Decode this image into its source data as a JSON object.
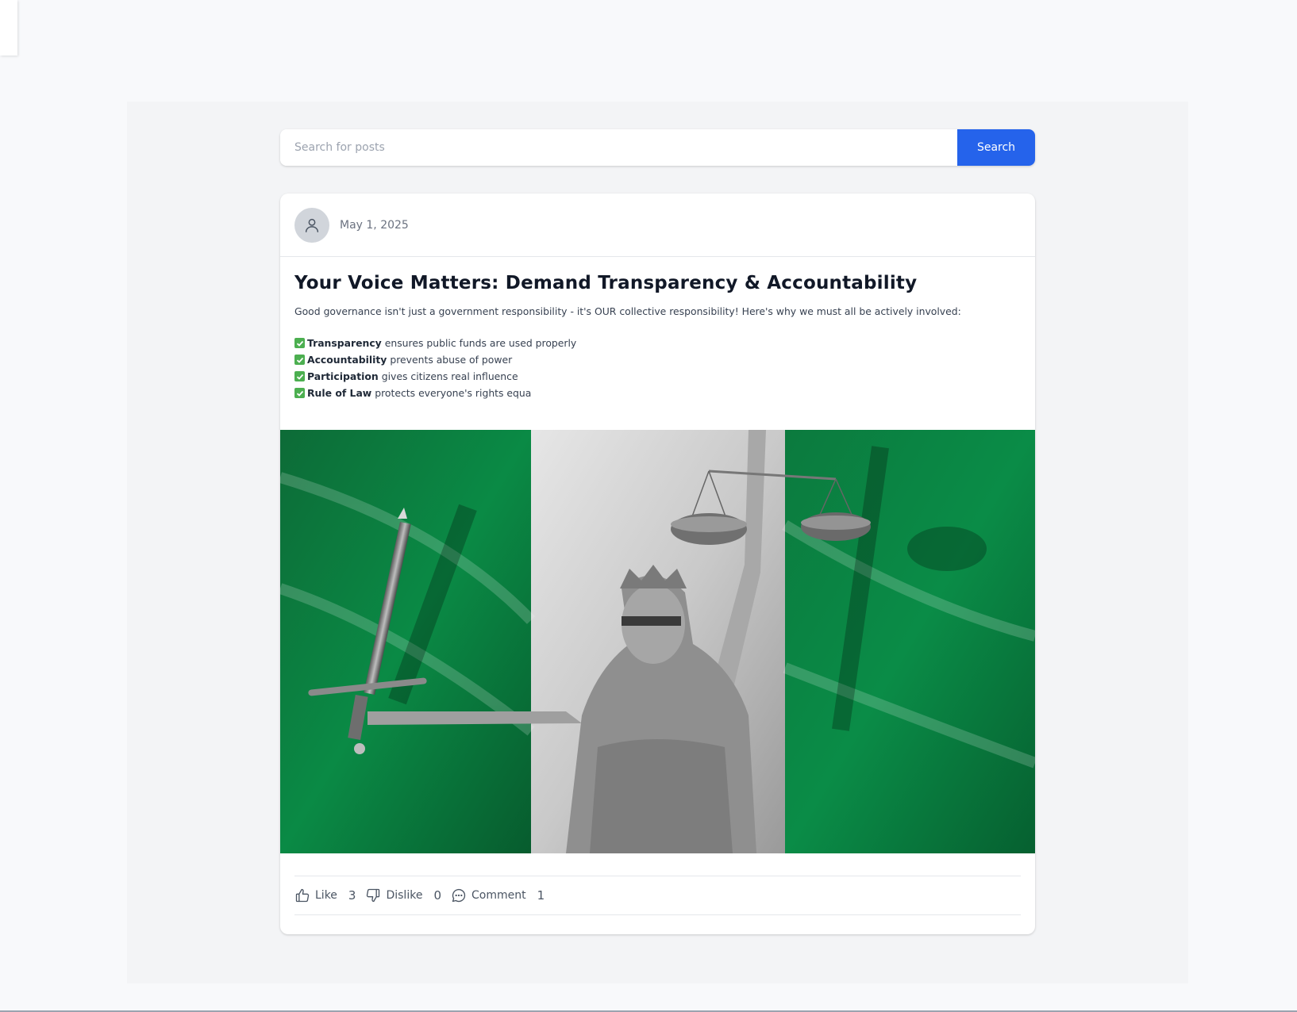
{
  "search": {
    "placeholder": "Search for posts",
    "button_label": "Search"
  },
  "post": {
    "date": "May 1, 2025",
    "title": "Your Voice Matters: Demand Transparency & Accountability",
    "intro": "Good governance isn't just a government responsibility - it's OUR collective responsibility! Here's why we must all be actively involved:",
    "points": [
      {
        "bold": "Transparency",
        "text": "ensures public funds are used properly"
      },
      {
        "bold": "Accountability",
        "text": "prevents abuse of power"
      },
      {
        "bold": "Participation",
        "text": "gives citizens real influence"
      },
      {
        "bold": "Rule of Law",
        "text": "protects everyone's rights equa"
      }
    ],
    "image": {
      "subject": "Statue of Lady Justice holding sword and scales over green-white-green flag"
    },
    "actions": {
      "like_label": "Like",
      "like_count": "3",
      "dislike_label": "Dislike",
      "dislike_count": "0",
      "comment_label": "Comment",
      "comment_count": "1"
    }
  },
  "colors": {
    "page_bg": "#f8f9fb",
    "panel_bg": "#f3f4f6",
    "accent": "#2563eb",
    "check_green": "#4caf50",
    "flag_green": "#0a7a3e"
  }
}
